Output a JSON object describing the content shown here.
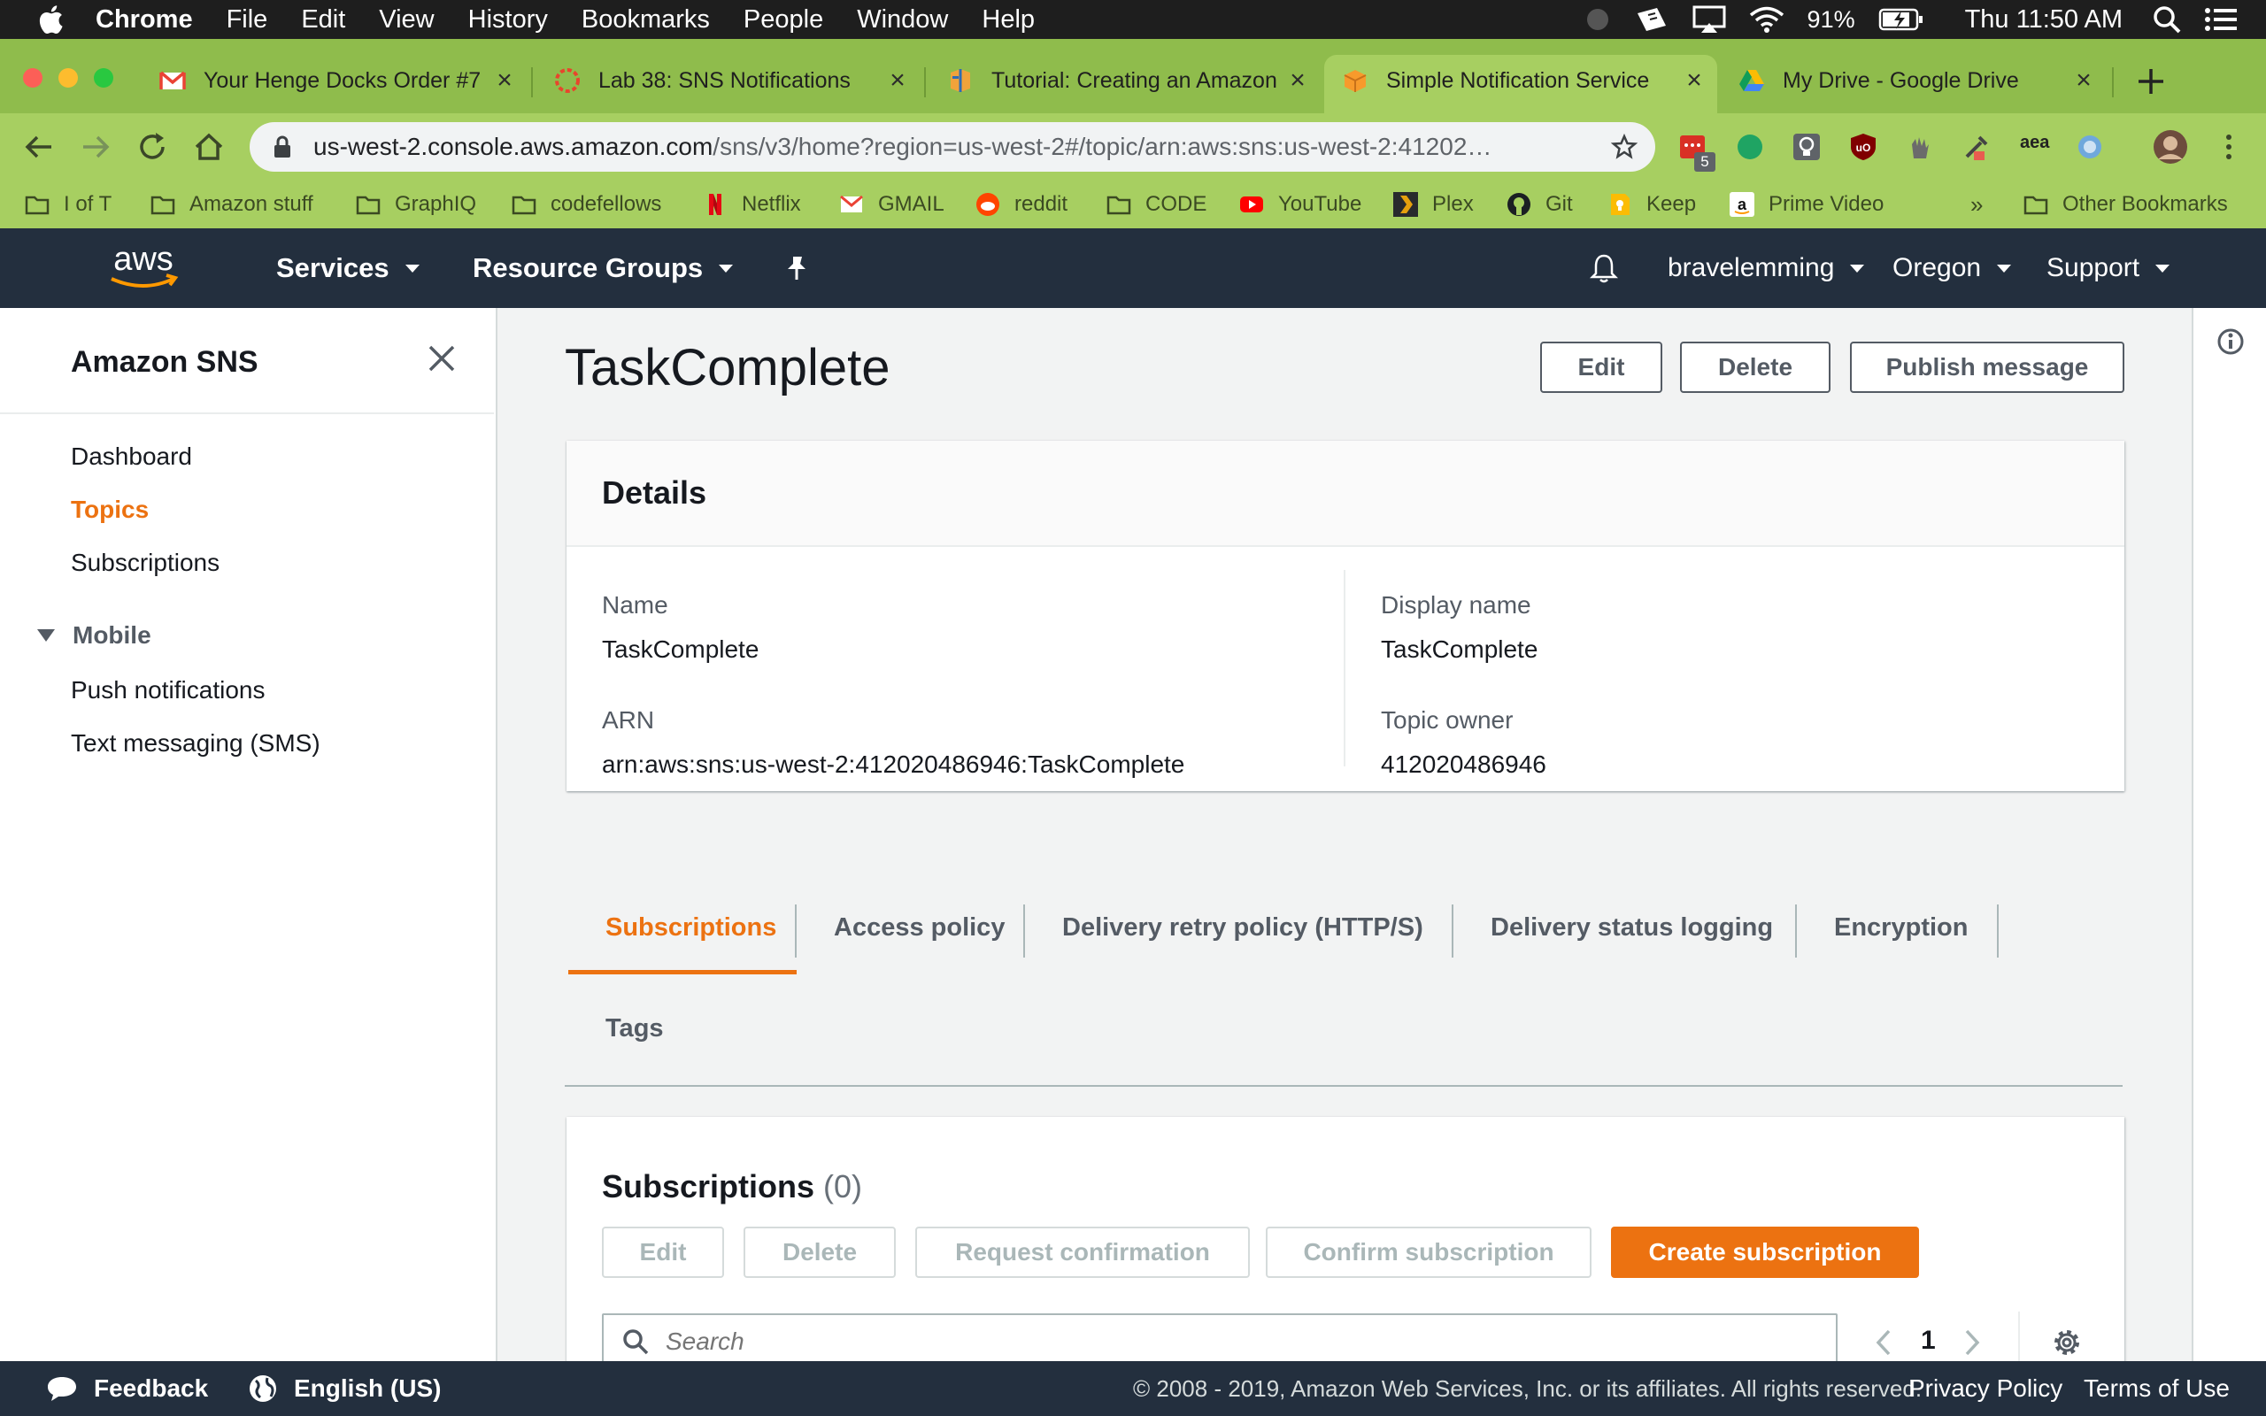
{
  "mac_menubar": {
    "app_name": "Chrome",
    "menus": [
      "File",
      "Edit",
      "View",
      "History",
      "Bookmarks",
      "People",
      "Window",
      "Help"
    ],
    "battery": "91%",
    "clock": "Thu 11:50 AM"
  },
  "browser": {
    "tabs": [
      {
        "title": "Your Henge Docks Order #7",
        "icon": "gmail-icon",
        "active": false
      },
      {
        "title": "Lab 38: SNS Notifications",
        "icon": "codefellows-icon",
        "active": false
      },
      {
        "title": "Tutorial: Creating an Amazon",
        "icon": "aws-docs-icon",
        "active": false
      },
      {
        "title": "Simple Notification Service",
        "icon": "aws-box-icon",
        "active": true
      },
      {
        "title": "My Drive - Google Drive",
        "icon": "google-drive-icon",
        "active": false
      }
    ],
    "address": {
      "host": "us-west-2.console.aws.amazon.com",
      "path": "/sns/v3/home?region=us-west-2#/topic/arn:aws:sns:us-west-2:41202…"
    },
    "extension_badge": "5",
    "extension_aea": "aea",
    "bookmarks": [
      "I of T",
      "Amazon stuff",
      "GraphIQ",
      "codefellows",
      "Netflix",
      "GMAIL",
      "reddit",
      "CODE",
      "YouTube",
      "Plex",
      "Git",
      "Keep",
      "Prime Video"
    ],
    "bookmarks_overflow": "»",
    "other_bookmarks": "Other Bookmarks"
  },
  "aws_nav": {
    "logo": "aws",
    "services": "Services",
    "resource_groups": "Resource Groups",
    "account": "bravelemming",
    "region": "Oregon",
    "support": "Support"
  },
  "sidenav": {
    "title": "Amazon SNS",
    "items": [
      "Dashboard",
      "Topics",
      "Subscriptions"
    ],
    "active_item": "Topics",
    "section": "Mobile",
    "section_items": [
      "Push notifications",
      "Text messaging (SMS)"
    ]
  },
  "topic": {
    "title": "TaskComplete",
    "actions": {
      "edit": "Edit",
      "delete": "Delete",
      "publish": "Publish message"
    },
    "details": {
      "header": "Details",
      "name_label": "Name",
      "name_value": "TaskComplete",
      "arn_label": "ARN",
      "arn_value": "arn:aws:sns:us-west-2:412020486946:TaskComplete",
      "display_name_label": "Display name",
      "display_name_value": "TaskComplete",
      "owner_label": "Topic owner",
      "owner_value": "412020486946"
    },
    "tabs": [
      "Subscriptions",
      "Access policy",
      "Delivery retry policy (HTTP/S)",
      "Delivery status logging",
      "Encryption",
      "Tags"
    ],
    "active_tab": "Subscriptions"
  },
  "subscriptions": {
    "title": "Subscriptions",
    "count": "(0)",
    "buttons": {
      "edit": "Edit",
      "delete": "Delete",
      "request_confirmation": "Request confirmation",
      "confirm_subscription": "Confirm subscription",
      "create": "Create subscription"
    },
    "search_placeholder": "Search",
    "page": "1"
  },
  "footer": {
    "feedback": "Feedback",
    "language": "English (US)",
    "copyright": "© 2008 - 2019, Amazon Web Services, Inc. or its affiliates. All rights reserved.",
    "privacy": "Privacy Policy",
    "terms": "Terms of Use"
  },
  "colors": {
    "aws_orange": "#ec7211",
    "aws_navy": "#232f3e",
    "chrome_theme": "#a7cf61"
  }
}
